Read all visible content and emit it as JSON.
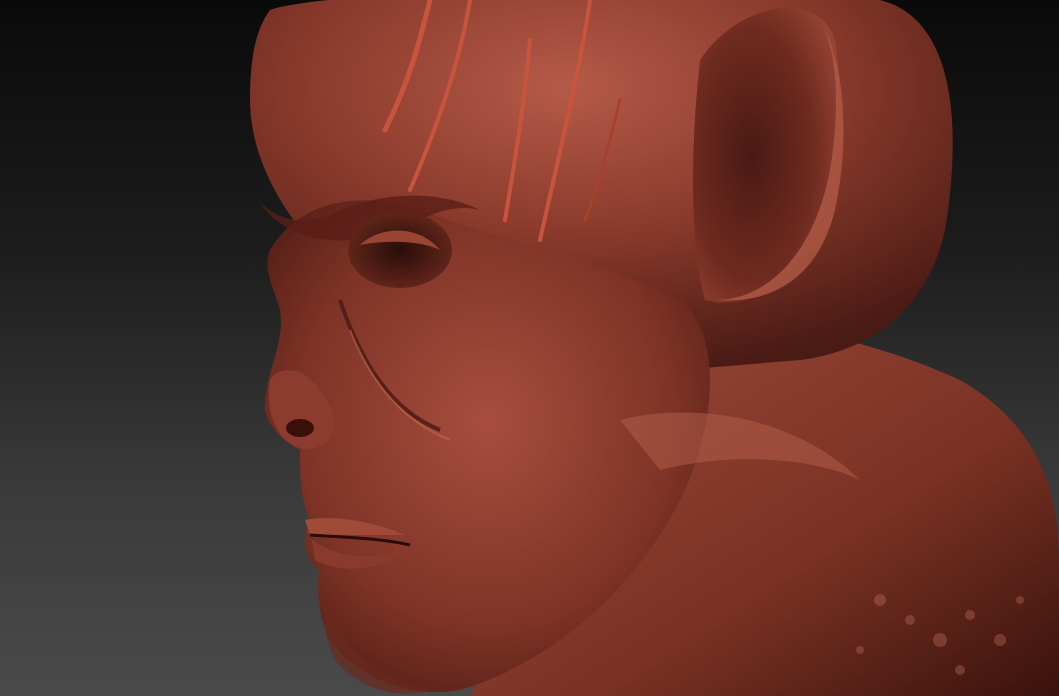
{
  "scene": {
    "subject": "",
    "material_colors": {
      "base": "#8a3a2c",
      "shadow": "#4a1a14",
      "highlight": "#c0705e",
      "deep_shadow": "#2a0c08"
    },
    "background_colors": {
      "top": "#0a0a0a",
      "bottom": "#4a4a4a"
    }
  }
}
